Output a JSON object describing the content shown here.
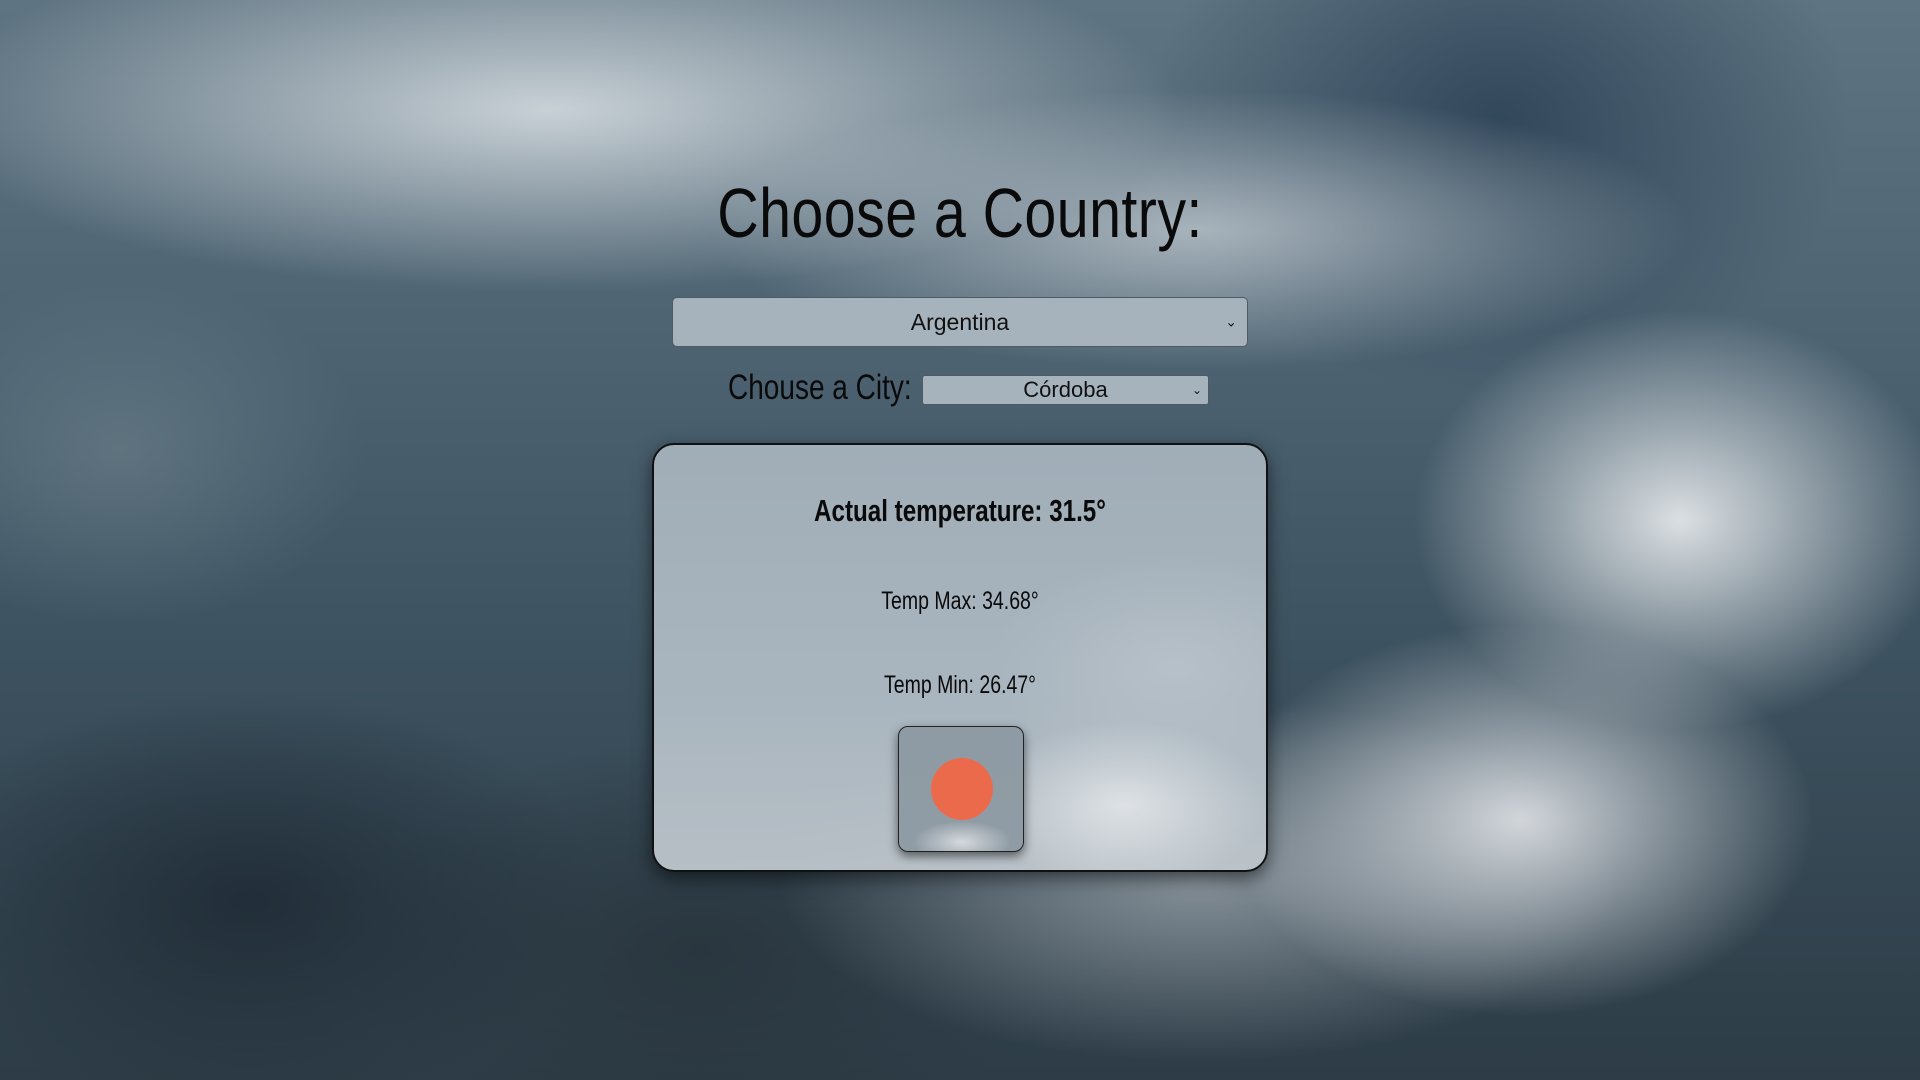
{
  "heading": "Choose a Country:",
  "country_select": {
    "selected": "Argentina"
  },
  "city_select": {
    "label": "Chouse a City:",
    "selected": "Córdoba"
  },
  "weather": {
    "actual": "Actual temperature: 31.5°",
    "max": "Temp Max: 34.68°",
    "min": "Temp Min: 26.47°",
    "icon": "sun-icon",
    "icon_color": "#ec6a4c"
  }
}
